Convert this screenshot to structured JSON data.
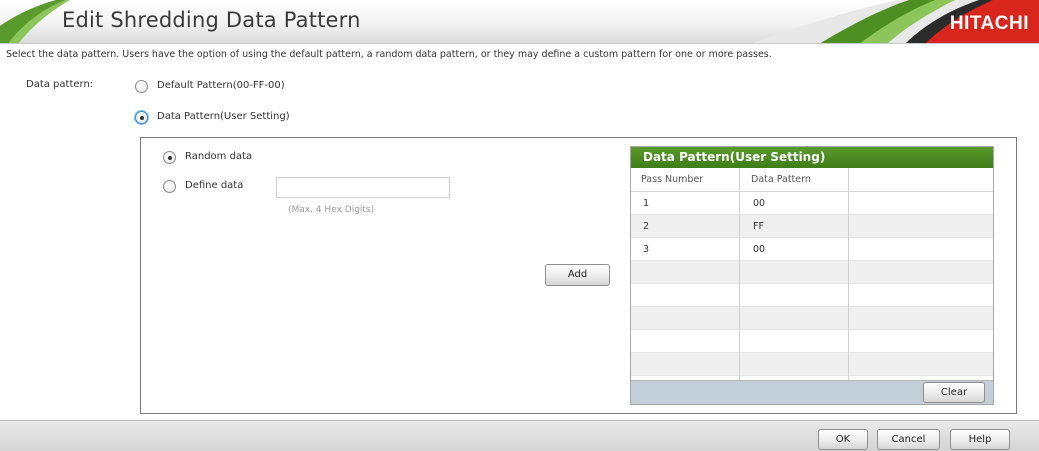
{
  "dialog": {
    "title": "Edit Shredding Data Pattern",
    "brand": "HITACHI",
    "description": "Select the data pattern. Users have the option of using the default pattern, a random data pattern, or they may define a custom pattern for one or more passes."
  },
  "form": {
    "data_pattern_label": "Data pattern:",
    "options": [
      {
        "label": "Default Pattern(00-FF-00)",
        "selected": false
      },
      {
        "label": "Data Pattern(User Setting)",
        "selected": true
      }
    ],
    "user_setting": {
      "random_label": "Random data",
      "random_selected": true,
      "define_label": "Define data",
      "define_value": "",
      "define_hint": "(Max. 4 Hex Digits)",
      "add_label": "Add"
    }
  },
  "table": {
    "title": "Data Pattern(User Setting)",
    "columns": [
      "Pass Number",
      "Data Pattern"
    ],
    "rows": [
      {
        "pass": "1",
        "pattern": "00"
      },
      {
        "pass": "2",
        "pattern": "FF"
      },
      {
        "pass": "3",
        "pattern": "00"
      }
    ],
    "clear_label": "Clear"
  },
  "footer": {
    "ok_label": "OK",
    "cancel_label": "Cancel",
    "help_label": "Help"
  },
  "colors": {
    "table_header": "#4a8a20",
    "brand_red": "#d9261c",
    "swoosh_green": "#5a9a2c",
    "focus_blue": "#2f8fd8"
  }
}
